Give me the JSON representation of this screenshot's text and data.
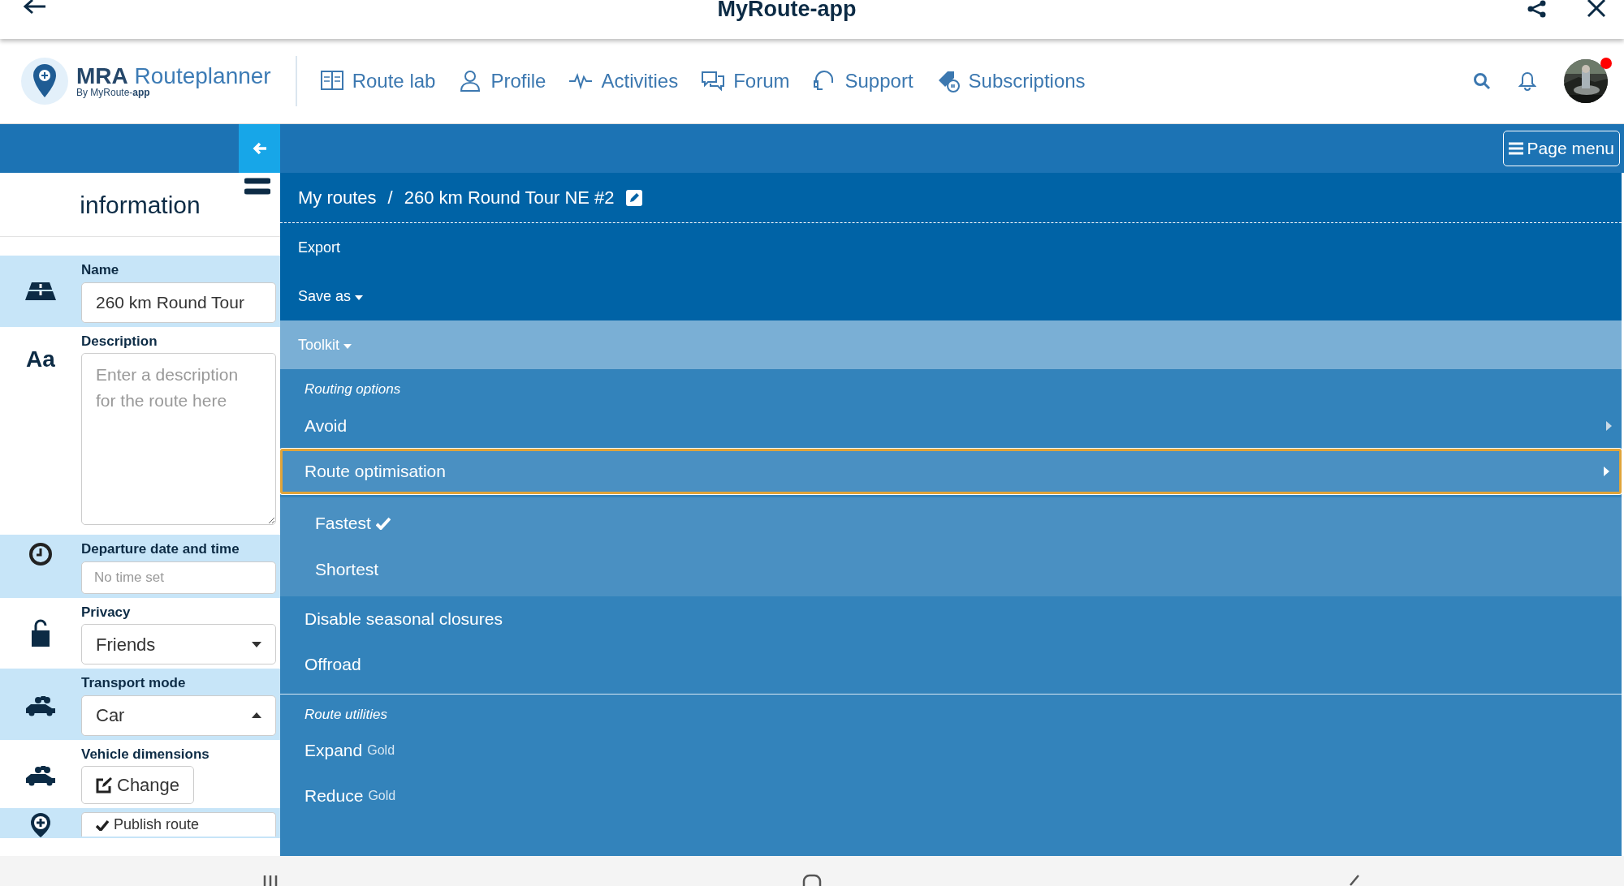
{
  "app_bar": {
    "title": "MyRoute-app"
  },
  "navbar": {
    "brand": {
      "name_bold": "MRA",
      "name": "Routeplanner",
      "tagline": "By MyRoute-**app**"
    },
    "links": [
      {
        "kind": "book",
        "label": "Route lab"
      },
      {
        "kind": "person",
        "label": "Profile"
      },
      {
        "kind": "pulse",
        "label": "Activities"
      },
      {
        "kind": "chat",
        "label": "Forum"
      },
      {
        "kind": "headset",
        "label": "Support"
      },
      {
        "kind": "tag",
        "label": "Subscriptions"
      }
    ],
    "has_notification": true
  },
  "toolbar": {
    "page_menu": "Page menu"
  },
  "sidebar": {
    "title": "information",
    "fields": [
      {
        "kind": "input",
        "label": "Name",
        "value": "260 km Round Tour"
      },
      {
        "kind": "textarea",
        "icon_text": "Aa",
        "label": "Description",
        "placeholder": "Enter a description for the route here"
      },
      {
        "kind": "input-small",
        "label": "Departure date and time",
        "placeholder": "No time set"
      },
      {
        "kind": "select",
        "label": "Privacy",
        "value": "Friends",
        "expanded": false
      },
      {
        "kind": "select",
        "label": "Transport mode",
        "value": "Car",
        "expanded": true
      },
      {
        "kind": "button",
        "label": "Vehicle dimensions",
        "button": "Change"
      },
      {
        "kind": "button-small",
        "button": "Publish route"
      }
    ]
  },
  "breadcrumb": [
    "My routes",
    "260 km Round Tour NE #2"
  ],
  "breadcrumb_separator": "/",
  "menu": [
    {
      "kind": "action",
      "label": "Export"
    },
    {
      "kind": "dropdown",
      "label": "Save as",
      "expanded": false
    },
    {
      "kind": "dropdown",
      "label": "Toolkit",
      "expanded": true
    }
  ],
  "toolkit": [
    {
      "heading": "Routing options",
      "items": [
        {
          "kind": "submenu",
          "label": "Avoid",
          "expanded": false
        },
        {
          "kind": "submenu",
          "label": "Route optimisation",
          "expanded": true,
          "children": [
            {
              "label": "Fastest",
              "checked": true
            },
            {
              "label": "Shortest",
              "checked": false
            }
          ]
        },
        {
          "kind": "item",
          "label": "Disable seasonal closures"
        },
        {
          "kind": "item",
          "label": "Offroad"
        }
      ]
    },
    {
      "heading": "Route utilities",
      "items": [
        {
          "kind": "item",
          "label": "Expand",
          "badge": "Gold"
        },
        {
          "kind": "item",
          "label": "Reduce",
          "badge": "Gold"
        }
      ]
    }
  ]
}
